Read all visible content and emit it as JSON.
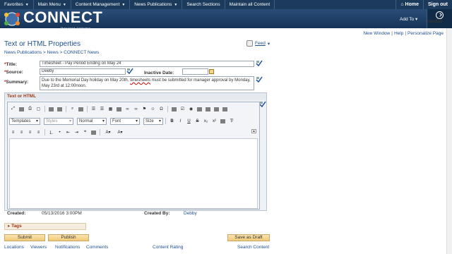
{
  "menubar": {
    "favorites": "Favorites",
    "main_menu": "Main Menu",
    "content_management": "Content Management",
    "news_publications": "News Publications",
    "search_sections": "Search Sections",
    "maintain_all": "Maintain all Content",
    "home": "Home",
    "signout": "Sign out"
  },
  "banner": {
    "logo": "CONNECT",
    "logo_sub": "Maryland Judiciary",
    "add_to": "Add To",
    "navbar": "NavBar"
  },
  "pagelinks": {
    "new_window": "New Window",
    "help": "Help",
    "personalize": "Personalize Page"
  },
  "page": {
    "title": "Text or HTML Properties",
    "feed": "Feed",
    "breadcrumb": "News Publications > News > CONNECT News"
  },
  "form": {
    "title_label": "Title:",
    "title_value": "Timesheet - Pay Period Ending on May 24",
    "source_label": "Source:",
    "source_value": "Deeby",
    "inactive_label": "Inactive Date:",
    "inactive_value": "",
    "summary_label": "Summary:",
    "summary_pre": "Due to the Memorial Day holiday on May 20th, ",
    "summary_mid": "timesheets",
    "summary_post": " must be submitted for manager approval by Monday, May 23rd at 12:00noon."
  },
  "editor": {
    "group_label": "Text or HTML",
    "templates": "Templates",
    "styles": "Styles",
    "format": "Normal",
    "font": "Font",
    "size": "Size"
  },
  "meta": {
    "created_label": "Created:",
    "created_value": "05/13/2016  3:00PM",
    "created_by_label": "Created By:",
    "created_by_value": "Debby"
  },
  "tags_label": "Tags",
  "buttons": {
    "submit": "Submit",
    "publish": "Publish",
    "save_draft": "Save as Draft"
  },
  "bottom_links": {
    "locations": "Locations",
    "viewers": "Viewers",
    "notifications": "Notifications",
    "comments": "Comments",
    "content_rating": "Content Rating",
    "search_content": "Search Content"
  }
}
